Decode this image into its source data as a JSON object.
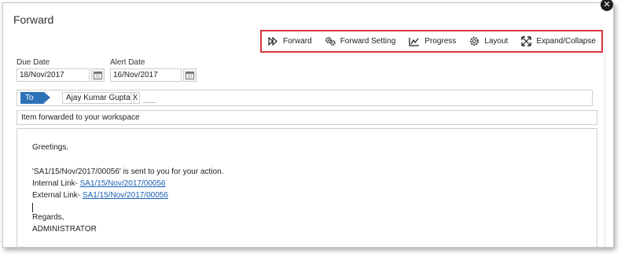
{
  "dialog": {
    "title": "Forward"
  },
  "toolbar": {
    "items": [
      {
        "label": "Forward",
        "icon": "double-play-icon"
      },
      {
        "label": "Forward Setting",
        "icon": "gears-icon"
      },
      {
        "label": "Progress",
        "icon": "line-chart-icon"
      },
      {
        "label": "Layout",
        "icon": "gear-icon"
      },
      {
        "label": "Expand/Collapse",
        "icon": "expand-arrows-icon"
      }
    ]
  },
  "form": {
    "due_date_label": "Due Date",
    "due_date_value": "18/Nov/2017",
    "alert_date_label": "Alert Date",
    "alert_date_value": "16/Nov/2017",
    "to_label": "To",
    "recipient": "Ajay Kumar Gupta",
    "recipient_remove": "X",
    "subject": "Item forwarded to your workspace"
  },
  "message": {
    "greeting": "Greetings,",
    "line1": "'SA1/15/Nov/2017/00056' is sent to you for your action.",
    "internal_prefix": "Internal Link- ",
    "internal_link": "SA1/15/Nov/2017/00056",
    "external_prefix": "External Link- ",
    "external_link": "SA1/15/Nov/2017/00056",
    "regards": "Regards,",
    "signature": "ADMINISTRATOR"
  },
  "colors": {
    "toolbar_border": "#d9363e",
    "to_badge": "#2c72b8",
    "link": "#1a5fb4"
  }
}
